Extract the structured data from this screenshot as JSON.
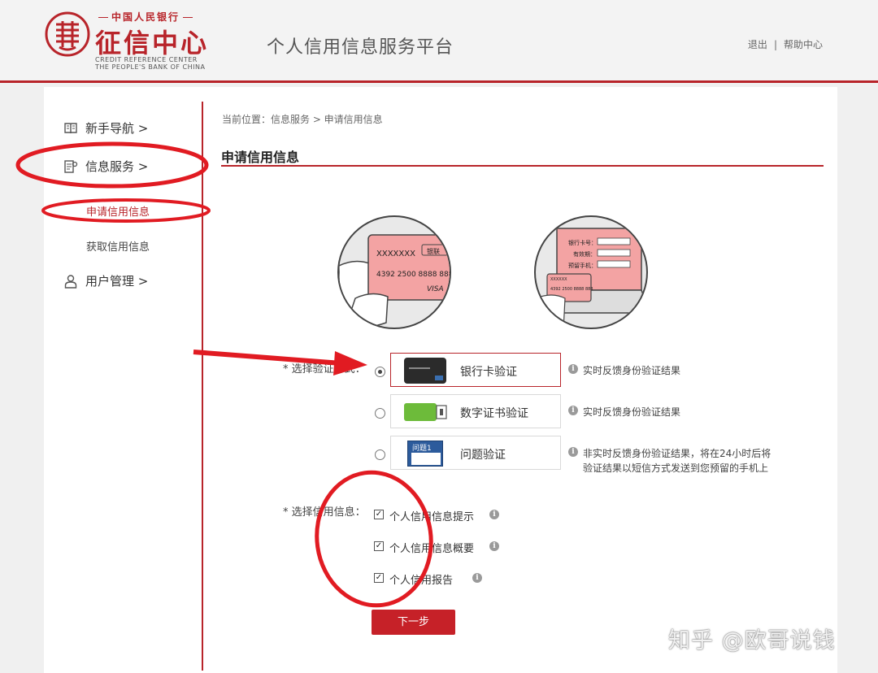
{
  "header": {
    "logo_top": "中国人民银行",
    "logo_main": "征信中心",
    "logo_en_line1": "CREDIT REFERENCE CENTER",
    "logo_en_line2": "THE PEOPLE'S BANK OF CHINA",
    "platform_title": "个人信用信息服务平台",
    "logout": "退出",
    "separator": "|",
    "help": "帮助中心"
  },
  "sidebar": {
    "items": [
      {
        "label": "新手导航 >",
        "icon": "book-icon"
      },
      {
        "label": "信息服务 >",
        "icon": "document-icon"
      },
      {
        "label": "用户管理 >",
        "icon": "user-icon"
      }
    ],
    "sub_items": [
      {
        "label": "申请信用信息",
        "active": true
      },
      {
        "label": "获取信用信息",
        "active": false
      }
    ]
  },
  "main": {
    "breadcrumb": "当前位置：信息服务 > 申请信用信息",
    "title": "申请信用信息",
    "illustration_card": {
      "card_name": "XXXXXXX",
      "card_number": "4392 2500 8888 888",
      "brand": "VISA",
      "unionpay": "银联"
    },
    "illustration_form": {
      "field1": "银行卡号：",
      "field2": "有效期：",
      "field3": "预留手机：",
      "card_name": "XXXXXX",
      "card_number": "4392 2500 8888 888"
    },
    "verify_label": "* 选择验证方式：",
    "verify_options": [
      {
        "label": "银行卡验证",
        "selected": true,
        "icon": "bank-card-icon",
        "note": "实时反馈身份验证结果"
      },
      {
        "label": "数字证书验证",
        "selected": false,
        "icon": "usb-key-icon",
        "note": "实时反馈身份验证结果"
      },
      {
        "label": "问题验证",
        "selected": false,
        "icon": "question-form-icon",
        "icon_text": "问题1",
        "note_line1": "非实时反馈身份验证结果，将在24小时后将",
        "note_line2": "验证结果以短信方式发送到您预留的手机上"
      }
    ],
    "info_label": "* 选择信用信息：",
    "info_options": [
      {
        "label": "个人信用信息提示",
        "checked": true
      },
      {
        "label": "个人信用信息概要",
        "checked": true
      },
      {
        "label": "个人信用报告",
        "checked": true
      }
    ],
    "next_button": "下一步"
  },
  "watermark": "知乎 @欧哥说钱",
  "colors": {
    "brand_red": "#b8242a",
    "button_red": "#c62128",
    "annotation_red": "#e11b22"
  }
}
